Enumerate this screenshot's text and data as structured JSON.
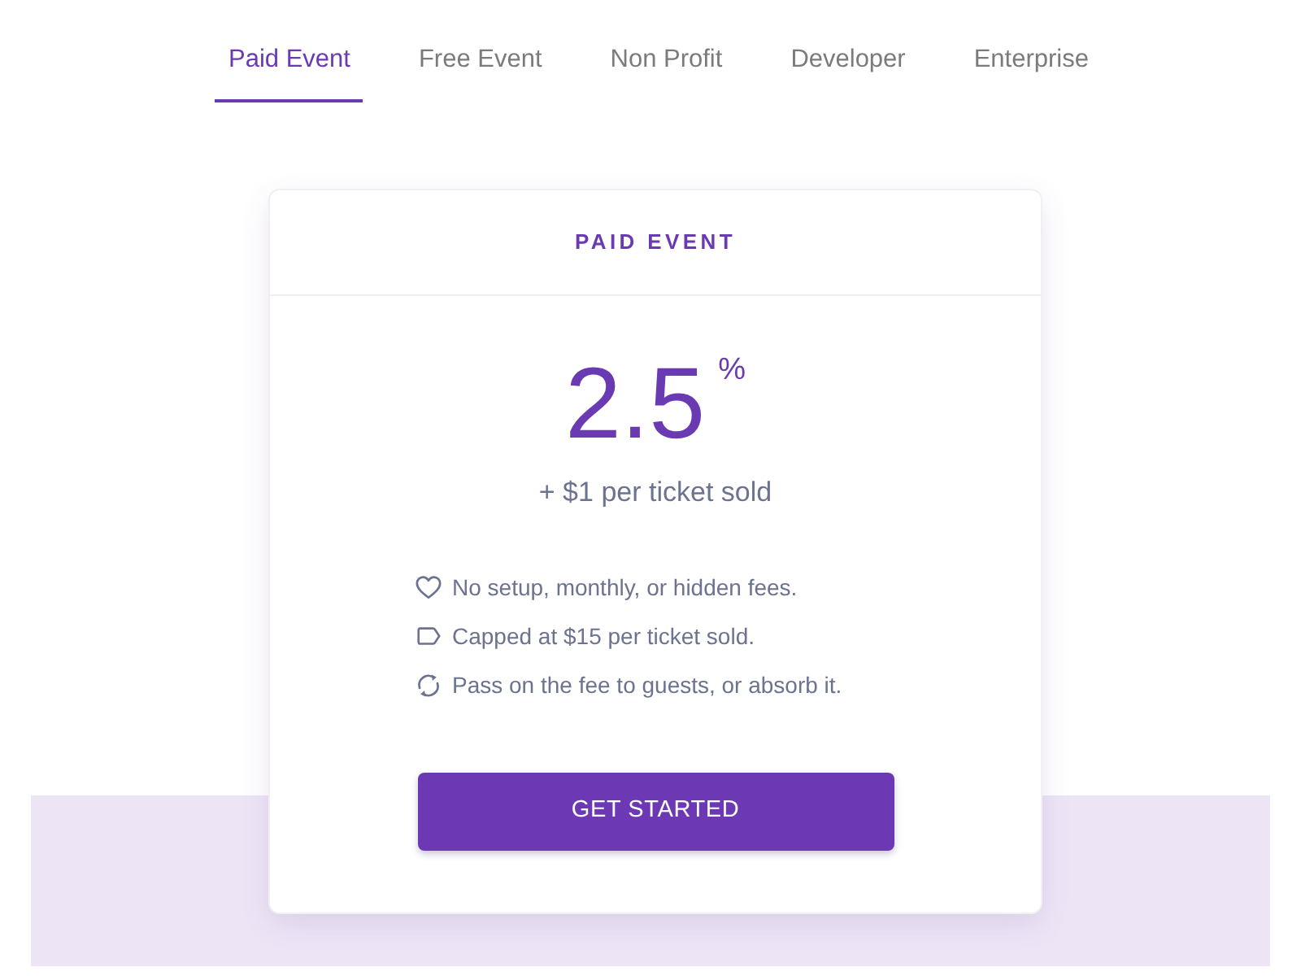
{
  "tabs": [
    {
      "label": "Paid Event",
      "selected": true
    },
    {
      "label": "Free Event",
      "selected": false
    },
    {
      "label": "Non Profit",
      "selected": false
    },
    {
      "label": "Developer",
      "selected": false
    },
    {
      "label": "Enterprise",
      "selected": false
    }
  ],
  "plan": {
    "title": "PAID EVENT",
    "price": "2.5",
    "price_unit": "%",
    "subtitle": "+ $1 per ticket sold",
    "features": [
      {
        "kind": "heart",
        "text": "No setup, monthly, or hidden fees."
      },
      {
        "kind": "tag",
        "text": "Capped at $15 per ticket sold."
      },
      {
        "kind": "sync",
        "text": "Pass on the fee to guests, or absorb it."
      }
    ],
    "button": "GET STARTED"
  }
}
